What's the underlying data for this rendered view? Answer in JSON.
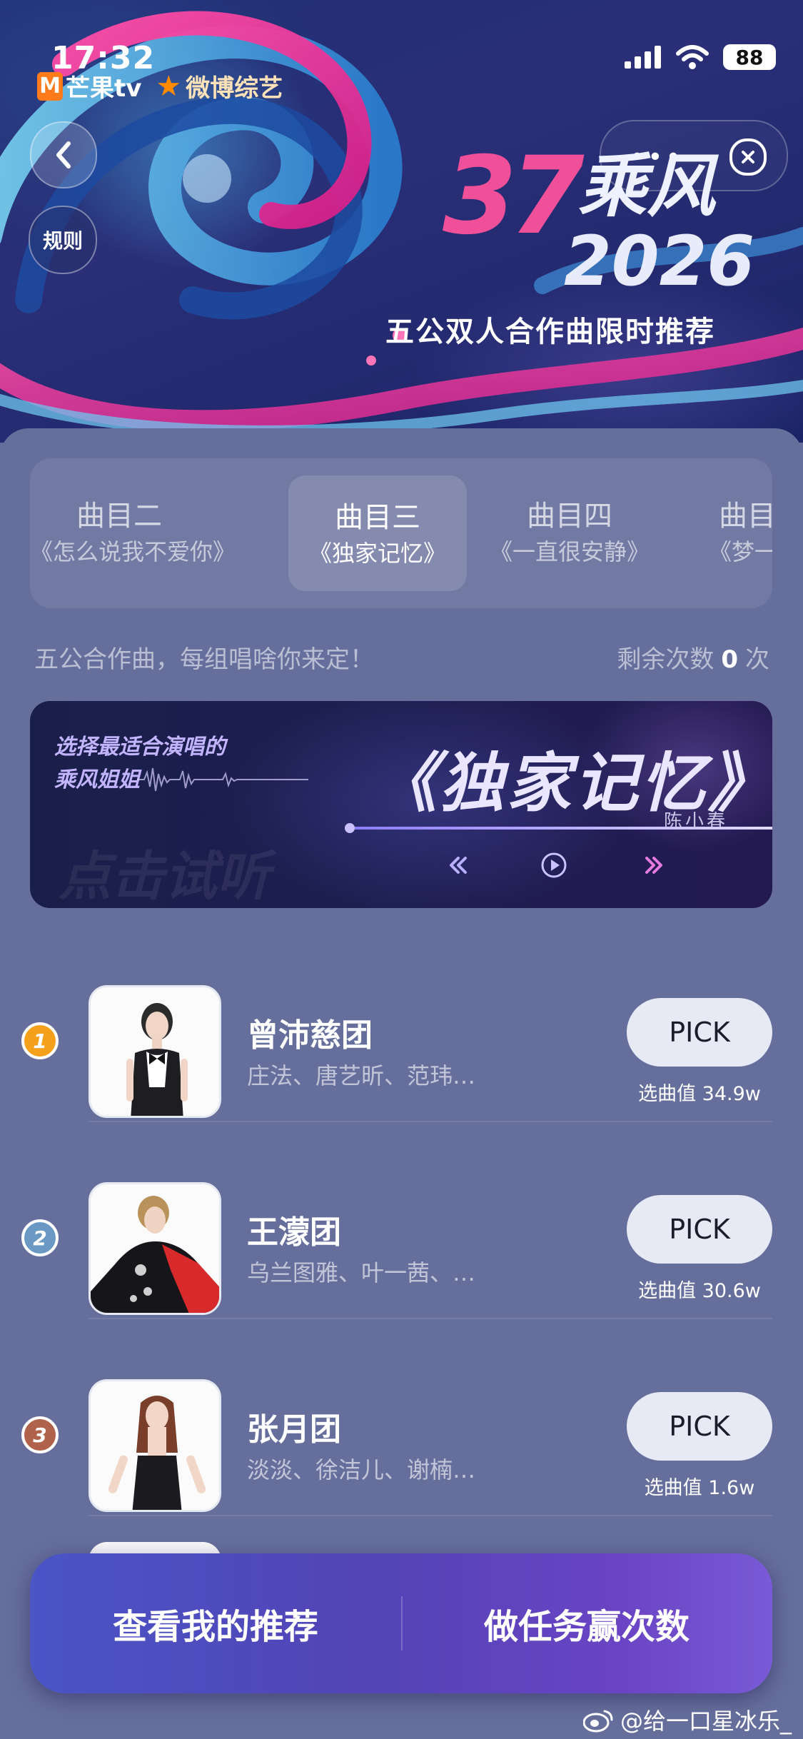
{
  "status_bar": {
    "time": "17:32",
    "battery": "88"
  },
  "header": {
    "logo_mango": "芒果tv",
    "logo_weibo": "微博综艺",
    "rules_label": "规则",
    "title_number": "37",
    "title_text": "乘风",
    "title_year": "2026",
    "subtitle": "五公双人合作曲限时推荐"
  },
  "tabs": [
    {
      "title": "曲目二",
      "song": "《怎么说我不爱你》",
      "active": false
    },
    {
      "title": "曲目三",
      "song": "《独家记忆》",
      "active": true
    },
    {
      "title": "曲目四",
      "song": "《一直很安静》",
      "active": false
    },
    {
      "title": "曲目",
      "song": "《梦一",
      "active": false
    }
  ],
  "hint": {
    "text": "五公合作曲，每组唱啥你来定！",
    "remaining_label": "剩余次数",
    "remaining_count": "0",
    "remaining_unit": "次"
  },
  "banner": {
    "choose_line1": "选择最适合演唱的",
    "choose_line2": "乘风姐姐",
    "song_title": "《独家记忆》",
    "singer": "陈小春",
    "tryout": "点击试听"
  },
  "list": [
    {
      "rank": "1",
      "rank_color": "#f5a11c",
      "name": "曾沛慈团",
      "members": "庄法、唐艺昕、范玮…",
      "pick_label": "PICK",
      "score": "选曲值 34.9w"
    },
    {
      "rank": "2",
      "rank_color": "#6a9ac4",
      "name": "王濛团",
      "members": "乌兰图雅、叶一茜、…",
      "pick_label": "PICK",
      "score": "选曲值 30.6w"
    },
    {
      "rank": "3",
      "rank_color": "#b0624a",
      "name": "张月团",
      "members": "淡淡、徐洁儿、谢楠…",
      "pick_label": "PICK",
      "score": "选曲值 1.6w"
    }
  ],
  "bottom": {
    "my_recommend": "查看我的推荐",
    "tasks": "做任务赢次数"
  },
  "watermark": "@给一口星冰乐_"
}
